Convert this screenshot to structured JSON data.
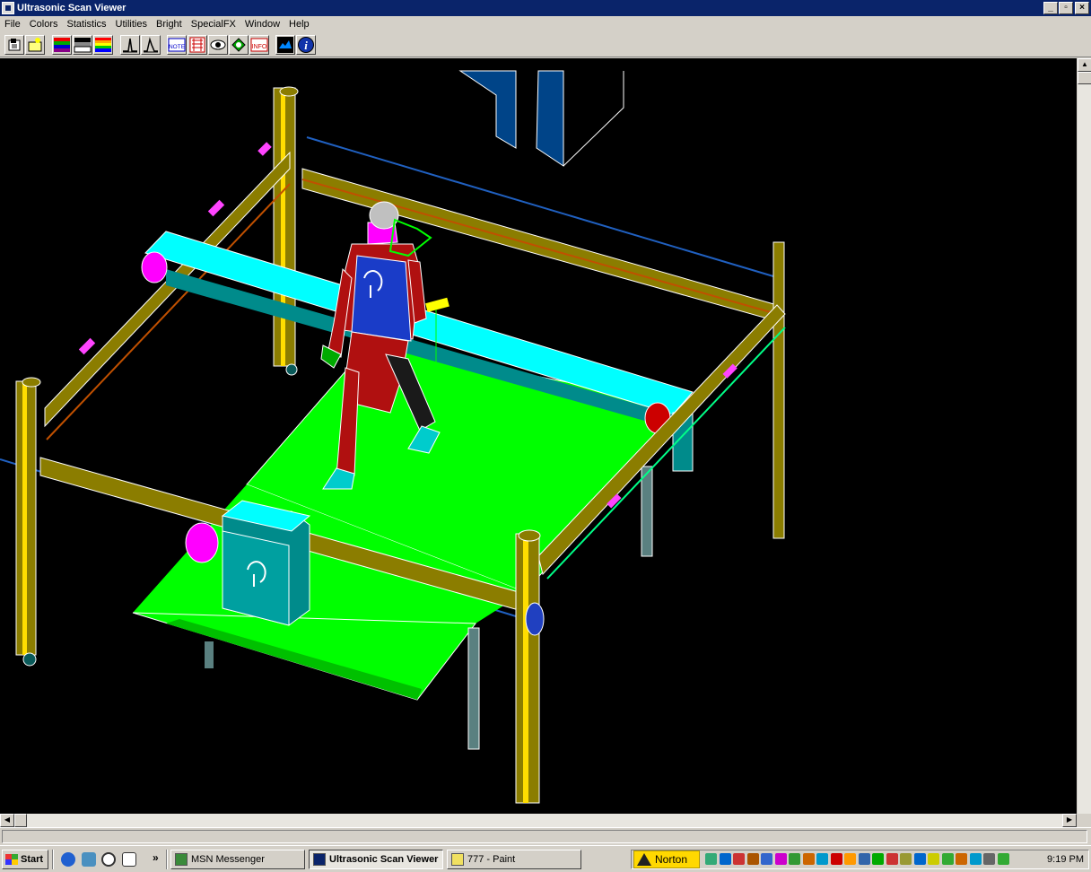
{
  "window": {
    "title": "Ultrasonic Scan Viewer",
    "controls": [
      "minimize",
      "restore",
      "close"
    ]
  },
  "menu": {
    "items": [
      "File",
      "Colors",
      "Statistics",
      "Utilities",
      "Bright",
      "SpecialFX",
      "Window",
      "Help"
    ]
  },
  "toolbar": {
    "buttons": [
      {
        "name": "open-icon"
      },
      {
        "name": "new-image-icon"
      },
      {
        "name": "palette-spectrum-icon"
      },
      {
        "name": "palette-gray-icon"
      },
      {
        "name": "palette-rainbow-icon"
      },
      {
        "name": "histogram-icon"
      },
      {
        "name": "histogram-alt-icon"
      },
      {
        "name": "note-icon",
        "label": "NOTE"
      },
      {
        "name": "ruler-icon"
      },
      {
        "name": "eye-icon"
      },
      {
        "name": "shape-icon"
      },
      {
        "name": "info-text-icon",
        "label": "INFO"
      },
      {
        "name": "scan-view-icon"
      },
      {
        "name": "about-info-icon",
        "label": "i"
      }
    ]
  },
  "scene": {
    "description_colors": {
      "background": "#000000",
      "platform": "#00ff00",
      "beam": "#00ffff",
      "frame": "#8b7d00",
      "robot_body": "#b01010",
      "robot_torso": "#1a3cc8",
      "motor": "#ff00ff"
    }
  },
  "taskbar": {
    "start_label": "Start",
    "more_label": "»",
    "tasks": [
      {
        "label": "MSN Messenger",
        "active": false
      },
      {
        "label": "Ultrasonic Scan Viewer",
        "active": true
      },
      {
        "label": "777 - Paint",
        "active": false
      }
    ],
    "norton_label": "Norton",
    "clock": "9:19 PM"
  }
}
